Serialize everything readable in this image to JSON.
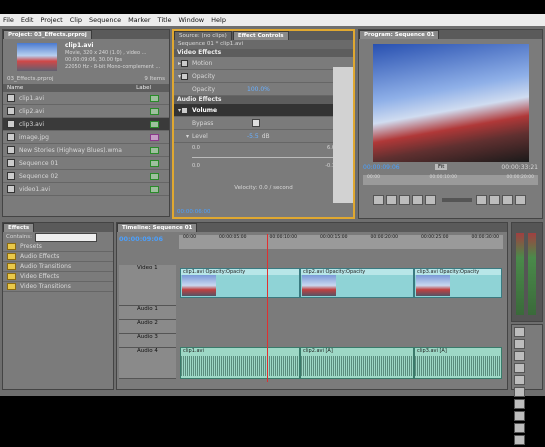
{
  "menu": [
    "File",
    "Edit",
    "Project",
    "Clip",
    "Sequence",
    "Marker",
    "Title",
    "Window",
    "Help"
  ],
  "project": {
    "tab": "Project: 03_Effects.prproj",
    "clip_name": "clip1.avi",
    "clip_info1": "Movie, 320 x 240 (1.0) , video ...",
    "clip_info2": "00:00:09:06, 30.00 fps",
    "clip_info3": "22050 Hz - 8-bit Mono-complement ...",
    "bin_name": "03_Effects.prproj",
    "item_count": "9 Items",
    "col_name": "Name",
    "col_label": "Label",
    "items": [
      {
        "name": "clip1.avi",
        "type": "video"
      },
      {
        "name": "clip2.avi",
        "type": "video"
      },
      {
        "name": "clip3.avi",
        "type": "video"
      },
      {
        "name": "image.jpg",
        "type": "image"
      },
      {
        "name": "New Stories (Highway Blues).wma",
        "type": "audio"
      },
      {
        "name": "Sequence 01",
        "type": "sequence"
      },
      {
        "name": "Sequence 02",
        "type": "sequence"
      },
      {
        "name": "video1.avi",
        "type": "video"
      }
    ]
  },
  "effect_controls": {
    "tab_source": "Source: (no clips)",
    "tab_active": "Effect Controls",
    "breadcrumb": "Sequence 01 * clip1.avi",
    "video_effects": "Video Effects",
    "motion": "Motion",
    "opacity_group": "Opacity",
    "opacity_label": "Opacity",
    "opacity_value": "100.0%",
    "audio_effects": "Audio Effects",
    "volume": "Volume",
    "bypass": "Bypass",
    "level": "Level",
    "level_value": "-5.5",
    "level_unit": "dB",
    "scale_min": "0.0",
    "scale_max": "6.0",
    "scale_low": "0.0",
    "scale_high": "-0.1",
    "velocity": "Velocity: 0.0 / second",
    "timecode": "00:00:06:00"
  },
  "program": {
    "tab": "Program: Sequence 01",
    "timecode_left": "00:00:09:06",
    "timecode_right": "00:00:33:21",
    "fit": "Fit",
    "ruler": [
      "00:00",
      "00:00:10:00",
      "00:00:20:00"
    ]
  },
  "effects": {
    "tab": "Effects",
    "contains_label": "Contains:",
    "folders": [
      "Presets",
      "Audio Effects",
      "Audio Transitions",
      "Video Effects",
      "Video Transitions"
    ]
  },
  "timeline": {
    "tab": "Timeline: Sequence 01",
    "timecode": "00:00:09:06",
    "ruler": [
      "00:00",
      "00:00:05:00",
      "00:00:10:00",
      "00:00:15:00",
      "00:00:20:00",
      "00:00:25:00",
      "00:00:30:00"
    ],
    "tracks": {
      "video1": "Video 1",
      "audio1": "Audio 1",
      "audio2": "Audio 2",
      "audio3": "Audio 3",
      "audio4": "Audio 4"
    },
    "clips": {
      "v1": "clip1.avi Opacity:Opacity",
      "v2": "clip2.avi Opacity:Opacity",
      "v3": "clip3.avi Opacity:Opacity",
      "a1": "clip1.avi",
      "a2": "clip2.avi [A]",
      "a3": "clip3.avi [A]"
    }
  }
}
